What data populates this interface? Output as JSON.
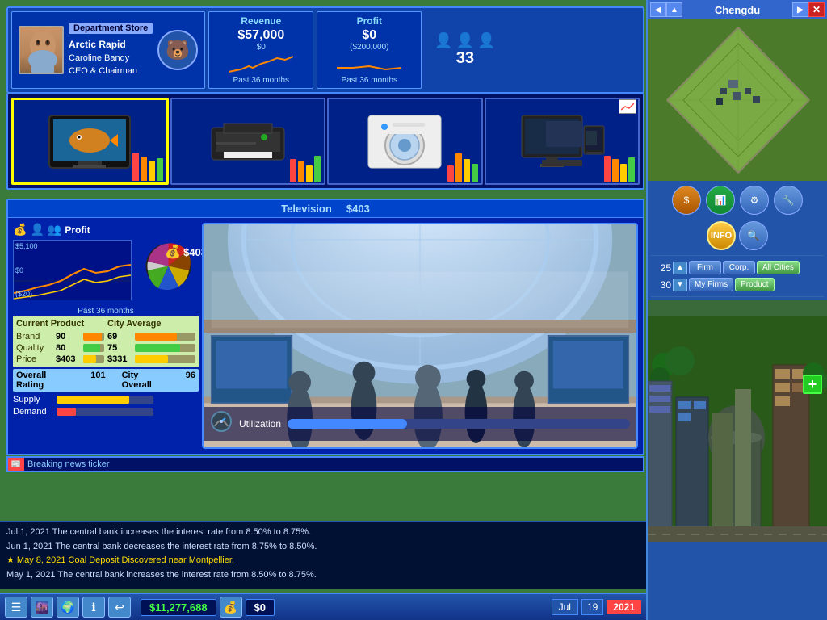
{
  "header": {
    "company_type": "Department Store",
    "company_name": "Arctic Rapid",
    "ceo_name": "Caroline Bandy",
    "ceo_title": "CEO & Chairman",
    "revenue_title": "Revenue",
    "revenue_value": "$57,000",
    "revenue_base": "$0",
    "revenue_period": "Past 36 months",
    "profit_title": "Profit",
    "profit_value": "$0",
    "profit_sub": "($200,000)",
    "profit_period": "Past 36 months",
    "employees": "33"
  },
  "products": [
    {
      "name": "Television",
      "icon": "📺",
      "selected": true
    },
    {
      "name": "Printer",
      "icon": "🖨️",
      "selected": false
    },
    {
      "name": "Washer",
      "icon": "🫧",
      "selected": false
    },
    {
      "name": "Monitor",
      "icon": "🖥️",
      "selected": false
    }
  ],
  "detail": {
    "product_name": "Television",
    "price": "$403",
    "profit_label": "Profit",
    "chart_top": "$5,100",
    "chart_mid": "$0",
    "chart_bot": "($20)",
    "past_months": "Past 36 months",
    "price_display": "$403",
    "current_product_label": "Current Product",
    "city_average_label": "City Average",
    "brand_label": "Brand",
    "brand_value": "90",
    "brand_city": "69",
    "quality_label": "Quality",
    "quality_value": "80",
    "quality_city": "75",
    "price_label": "Price",
    "price_value": "$403",
    "price_city": "$331",
    "overall_label": "Overall Rating",
    "overall_value": "101",
    "city_overall_label": "City Overall",
    "city_overall_value": "96",
    "supply_label": "Supply",
    "demand_label": "Demand",
    "utilization_label": "Utilization",
    "supply_pct": 75,
    "demand_pct": 20,
    "util_pct": 35
  },
  "minimap": {
    "city_name": "Chengdu",
    "num1": "25",
    "label1": "Firm",
    "num2": "30",
    "label2": "My Firms",
    "btn_firm": "Firm",
    "btn_corp": "Corp.",
    "btn_all_cities": "All Cities",
    "btn_my_firms": "My Firms",
    "btn_product": "Product",
    "info_label": "INFO"
  },
  "log": {
    "entries": [
      "Jul 1, 2021 The central bank increases the interest rate from 8.50% to 8.75%.",
      "Jun 1, 2021 The central bank decreases the interest rate from 8.75% to 8.50%.",
      "★ May 8, 2021 Coal Deposit Discovered near Montpellier.",
      "May 1, 2021 The central bank increases the interest rate from 8.50% to 8.75%."
    ]
  },
  "toolbar": {
    "money1": "$11,277,688",
    "money2": "$0",
    "date_month": "Jul",
    "date_day": "19",
    "date_year": "2021"
  }
}
